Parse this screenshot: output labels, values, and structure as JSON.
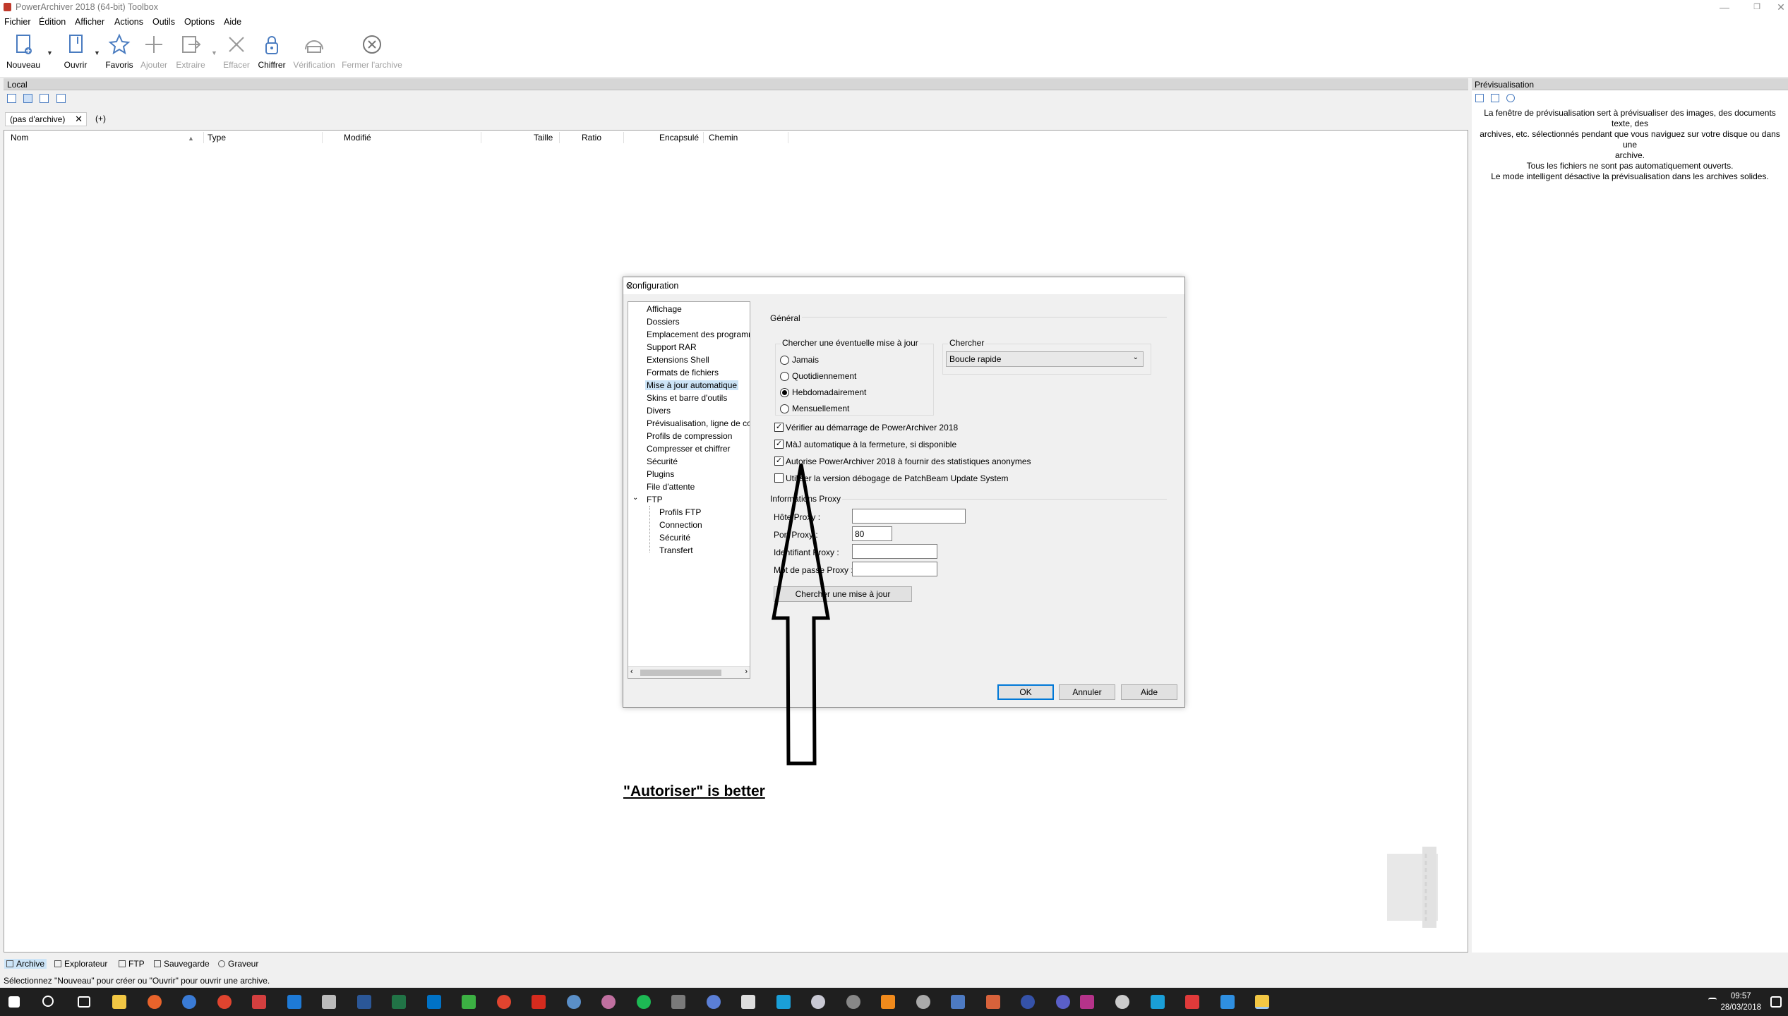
{
  "window": {
    "title": "PowerArchiver 2018 (64-bit) Toolbox",
    "min": "—",
    "restore": "❐",
    "close": "✕"
  },
  "menu": [
    "Fichier",
    "Édition",
    "Afficher",
    "Actions",
    "Outils",
    "Options",
    "Aide"
  ],
  "toolbar": [
    {
      "label": "Nouveau",
      "icon": "new-archive-icon",
      "enabled": true
    },
    {
      "label": "Ouvrir",
      "icon": "open-archive-icon",
      "enabled": true
    },
    {
      "label": "Favoris",
      "icon": "star-icon",
      "enabled": true
    },
    {
      "label": "Ajouter",
      "icon": "plus-icon",
      "enabled": false
    },
    {
      "label": "Extraire",
      "icon": "extract-icon",
      "enabled": false
    },
    {
      "label": "Effacer",
      "icon": "delete-x-icon",
      "enabled": false
    },
    {
      "label": "Chiffrer",
      "icon": "lock-icon",
      "enabled": true
    },
    {
      "label": "Vérification",
      "icon": "verify-icon",
      "enabled": false
    },
    {
      "label": "Fermer l'archive",
      "icon": "close-archive-icon",
      "enabled": false
    }
  ],
  "local": {
    "title": "Local",
    "tab": "(pas d'archive)",
    "tab_close": "✕",
    "add_tab": "(+)"
  },
  "columns": [
    "Nom",
    "Type",
    "Modifié",
    "Taille",
    "Ratio",
    "Encapsulé",
    "Chemin"
  ],
  "preview": {
    "title": "Prévisualisation",
    "lines": [
      "La fenêtre de prévisualisation sert à prévisualiser des images, des documents texte, des",
      "archives, etc. sélectionnés pendant que vous naviguez sur votre disque ou dans une",
      "archive.",
      "Tous les fichiers ne sont pas automatiquement ouverts.",
      "Le mode intelligent désactive la prévisualisation dans les archives solides."
    ]
  },
  "dialog": {
    "title": "Configuration",
    "tree": [
      {
        "label": "Affichage",
        "level": 0
      },
      {
        "label": "Dossiers",
        "level": 0
      },
      {
        "label": "Emplacement des programmes",
        "level": 0
      },
      {
        "label": "Support RAR",
        "level": 0
      },
      {
        "label": "Extensions Shell",
        "level": 0
      },
      {
        "label": "Formats de fichiers",
        "level": 0
      },
      {
        "label": "Mise à jour automatique",
        "level": 0,
        "selected": true
      },
      {
        "label": "Skins et barre d'outils",
        "level": 0
      },
      {
        "label": "Divers",
        "level": 0
      },
      {
        "label": "Prévisualisation, ligne de commande",
        "level": 0
      },
      {
        "label": "Profils de compression",
        "level": 0
      },
      {
        "label": "Compresser et chiffrer",
        "level": 0
      },
      {
        "label": "Sécurité",
        "level": 0
      },
      {
        "label": "Plugins",
        "level": 0
      },
      {
        "label": "File d'attente",
        "level": 0
      },
      {
        "label": "FTP",
        "level": 0,
        "expanded": true
      },
      {
        "label": "Profils FTP",
        "level": 1
      },
      {
        "label": "Connection",
        "level": 1
      },
      {
        "label": "Sécurité",
        "level": 1
      },
      {
        "label": "Transfert",
        "level": 1
      }
    ],
    "general_label": "Général",
    "check_group_label": "Chercher une éventuelle mise à jour",
    "radios": [
      {
        "label": "Jamais",
        "checked": false
      },
      {
        "label": "Quotidiennement",
        "checked": false
      },
      {
        "label": "Hebdomadairement",
        "checked": true
      },
      {
        "label": "Mensuellement",
        "checked": false
      }
    ],
    "search_group_label": "Chercher",
    "search_value": "Boucle rapide",
    "checkboxes": [
      {
        "label": "Vérifier au démarrage de PowerArchiver 2018",
        "checked": true
      },
      {
        "label": "MàJ automatique à la fermeture, si disponible",
        "checked": true
      },
      {
        "label": "Autorise PowerArchiver 2018 à fournir des statistiques anonymes",
        "checked": true
      },
      {
        "label": "Utiliser la version débogage de PatchBeam Update System",
        "checked": false
      }
    ],
    "proxy_label": "Informations Proxy",
    "proxy_fields": [
      {
        "label": "Hôte Proxy :",
        "value": ""
      },
      {
        "label": "Port Proxy :",
        "value": "80"
      },
      {
        "label": "Identifiant Proxy :",
        "value": ""
      },
      {
        "label": "Mot de passe Proxy :",
        "value": ""
      }
    ],
    "check_button": "Chercher une mise à jour",
    "ok": "OK",
    "cancel": "Annuler",
    "help": "Aide",
    "close": "✕"
  },
  "annotation": "\"Autoriser\" is better",
  "bottom_tabs": [
    {
      "label": "Archive",
      "selected": true
    },
    {
      "label": "Explorateur"
    },
    {
      "label": "FTP"
    },
    {
      "label": "Sauvegarde"
    },
    {
      "label": "Graveur"
    }
  ],
  "status": "Sélectionnez \"Nouveau\" pour créer ou \"Ouvrir\" pour ouvrir une archive.",
  "clock": {
    "time": "09:57",
    "date": "28/03/2018"
  },
  "colors": {
    "accent": "#0078d7",
    "selection": "#cce4f7",
    "taskbar": "#1f1f1f"
  }
}
